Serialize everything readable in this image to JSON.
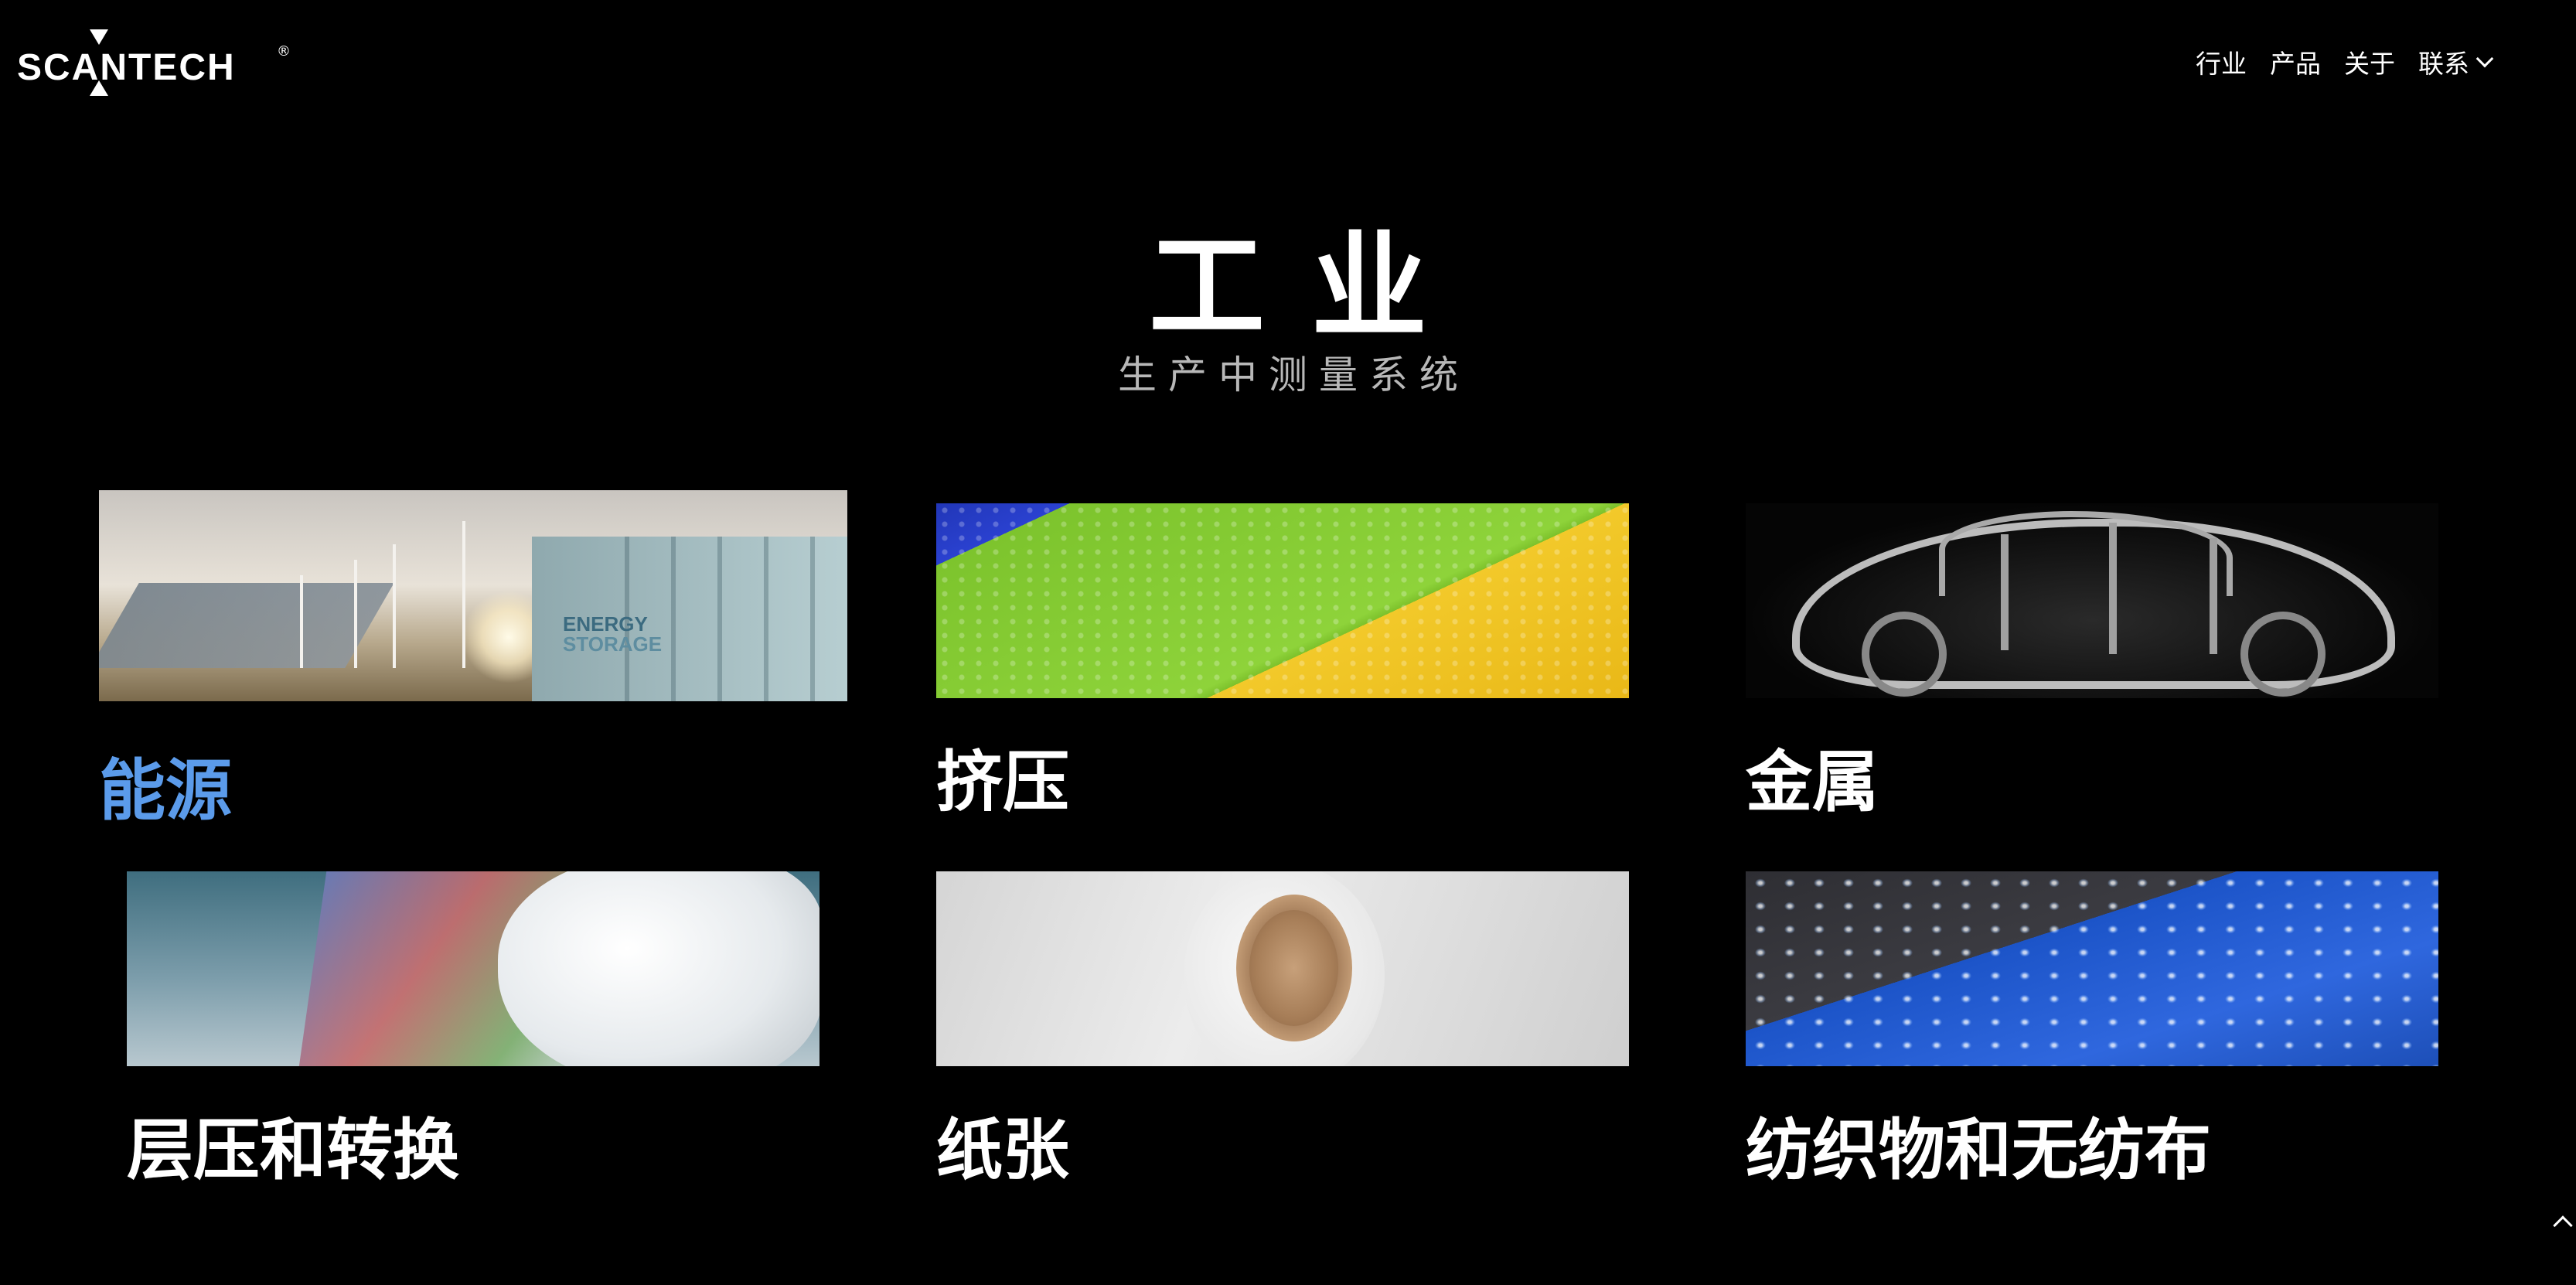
{
  "brand": {
    "logo_text": "SCANTECH",
    "registered_mark": "®"
  },
  "nav": {
    "items": [
      {
        "label": "行业"
      },
      {
        "label": "产品"
      },
      {
        "label": "关于"
      },
      {
        "label": "联系"
      }
    ]
  },
  "hero": {
    "title": "工业",
    "subtitle": "生产中测量系统"
  },
  "industries": [
    {
      "label": "能源",
      "active": true,
      "image_icon": "energy-storage-image",
      "image_text": [
        "ENERGY",
        "STORAGE"
      ]
    },
    {
      "label": "挤压",
      "active": false,
      "image_icon": "plastic-pellets-image"
    },
    {
      "label": "金属",
      "active": false,
      "image_icon": "car-body-frame-image"
    },
    {
      "label": "层压和转换",
      "active": false,
      "image_icon": "glass-laminate-image"
    },
    {
      "label": "纸张",
      "active": false,
      "image_icon": "paper-roll-image"
    },
    {
      "label": "纺织物和无纺布",
      "active": false,
      "image_icon": "textile-water-drops-image"
    }
  ],
  "colors": {
    "background": "#000000",
    "text": "#ffffff",
    "active_label": "#5b9bea",
    "subtitle": "#b8b8b8"
  }
}
